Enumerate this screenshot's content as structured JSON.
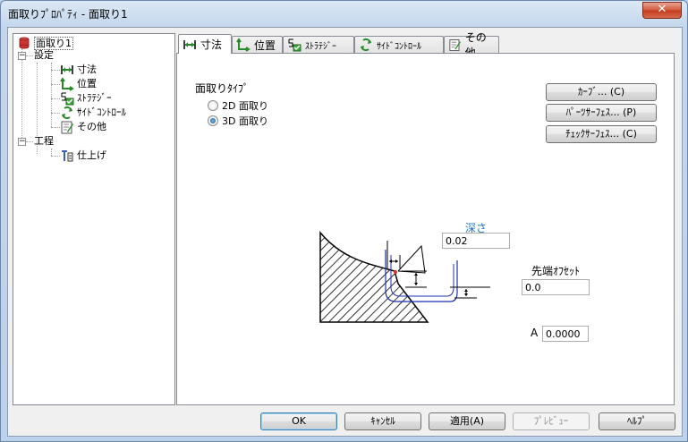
{
  "window": {
    "title": "面取りﾌﾟﾛﾊﾟﾃｨ - 面取り1",
    "close_label": "✕"
  },
  "tree": {
    "items": [
      {
        "label": "面取り1",
        "icon": "chamfer-feature-icon",
        "color": "#c23030"
      },
      {
        "label": "設定",
        "icon": "none"
      },
      {
        "label": "寸法",
        "icon": "dimension-icon",
        "color": "#2a8a2a"
      },
      {
        "label": "位置",
        "icon": "position-icon",
        "color": "#2a8a2a"
      },
      {
        "label": "ｽﾄﾗﾃｼﾞｰ",
        "icon": "strategy-icon",
        "color": "#2a8a2a"
      },
      {
        "label": "ｻｲﾄﾞｺﾝﾄﾛｰﾙ",
        "icon": "side-control-icon",
        "color": "#2a8a2a"
      },
      {
        "label": "その他",
        "icon": "other-icon",
        "color": "#2a8a2a"
      },
      {
        "label": "工程",
        "icon": "none"
      },
      {
        "label": "仕上げ",
        "icon": "finish-icon",
        "color": "#3a5fc0"
      }
    ]
  },
  "tabs": [
    {
      "label": "寸法",
      "icon": "dimension-icon",
      "active": true
    },
    {
      "label": "位置",
      "icon": "position-icon",
      "active": false
    },
    {
      "label": "ｽﾄﾗﾃｼﾞｰ",
      "icon": "strategy-icon",
      "active": false
    },
    {
      "label": "ｻｲﾄﾞｺﾝﾄﾛｰﾙ",
      "icon": "side-control-icon",
      "active": false
    },
    {
      "label": "その他",
      "icon": "other-icon",
      "active": false
    }
  ],
  "panel": {
    "type_label": "面取りﾀｲﾌﾟ",
    "radio_2d": "2D 面取り",
    "radio_3d": "3D 面取り",
    "selected_type": "3D 面取り",
    "curve_button": "ｶｰﾌﾞ... (C)",
    "parts_surface_button": "ﾊﾟｰﾂｻｰﾌｪｽ... (P)",
    "check_surface_button": "ﾁｪｯｸｻｰﾌｪｽ... (C)",
    "depth_label": "深さ",
    "depth_value": "0.02",
    "tip_offset_label": "先端ｵﾌｾｯﾄ",
    "tip_offset_value": "0.0",
    "a_label": "A",
    "a_value": "0.0000"
  },
  "footer": {
    "ok": "OK",
    "cancel": "ｷｬﾝｾﾙ",
    "apply": "適用(A)",
    "preview": "ﾌﾟﾚﾋﾞｭｰ",
    "help": "ﾍﾙﾌﾟ"
  },
  "colors": {
    "accent_blue": "#1e6fb8",
    "tool_path": "#1e2fb0",
    "tip_marker": "#e03030"
  }
}
